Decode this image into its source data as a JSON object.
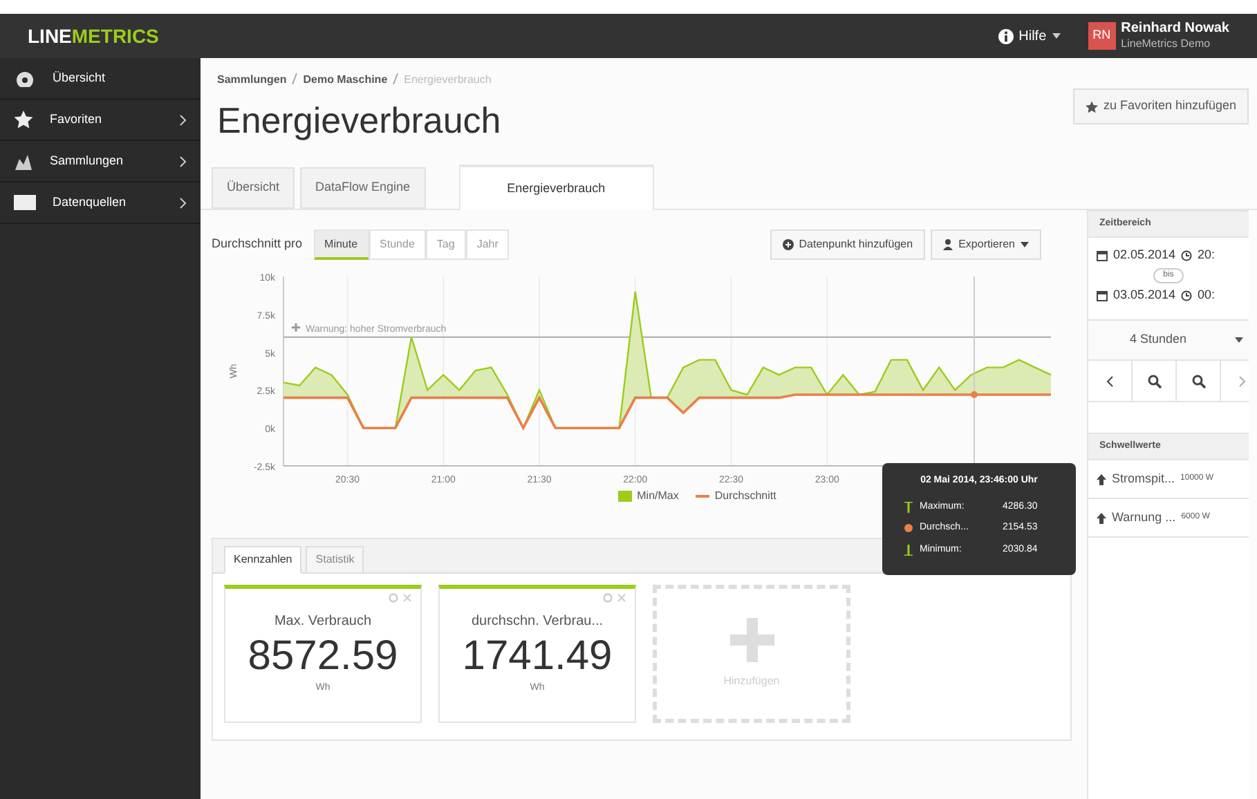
{
  "app": {
    "logo_left": "LINE",
    "logo_right": "METRICS"
  },
  "topbar": {
    "help": "Hilfe",
    "user": {
      "initials": "RN",
      "name": "Reinhard Nowak",
      "org": "LineMetrics Demo"
    }
  },
  "sidebar": {
    "items": [
      {
        "label": "Übersicht",
        "expandable": false
      },
      {
        "label": "Favoriten",
        "expandable": true
      },
      {
        "label": "Sammlungen",
        "expandable": true
      },
      {
        "label": "Datenquellen",
        "expandable": true
      }
    ]
  },
  "breadcrumb": [
    "Sammlungen",
    "Demo Maschine",
    "Energieverbrauch"
  ],
  "title": "Energieverbrauch",
  "favorite_button": "zu Favoriten hinzufügen",
  "tabs": [
    {
      "label": "Übersicht",
      "selected": false
    },
    {
      "label": "DataFlow Engine",
      "selected": false
    },
    {
      "label": "Energieverbrauch",
      "selected": true
    }
  ],
  "averaging": {
    "label": "Durchschnitt pro",
    "options": [
      {
        "label": "Minute",
        "selected": true
      },
      {
        "label": "Stunde",
        "selected": false
      },
      {
        "label": "Tag",
        "selected": false
      },
      {
        "label": "Jahr",
        "selected": false
      }
    ]
  },
  "chart_buttons": [
    "Datenpunkt hinzufügen",
    "Exportieren"
  ],
  "chart": {
    "chart_data": {
      "type": "line",
      "ylabel": "Wh",
      "categories": [
        null,
        null,
        null,
        null,
        "20:30",
        null,
        null,
        null,
        null,
        null,
        "21:00",
        null,
        null,
        null,
        null,
        null,
        "21:30",
        null,
        null,
        null,
        null,
        null,
        "22:00",
        null,
        null,
        null,
        null,
        null,
        "22:30",
        null,
        null,
        null,
        null,
        null,
        "23:00",
        null,
        null,
        null,
        null,
        null,
        null,
        null,
        null,
        null,
        null,
        null,
        null,
        null,
        null
      ],
      "series": [
        {
          "name": "Min/Max",
          "color": "#9ccc1c",
          "values": [
            3000,
            2800,
            4000,
            3500,
            2200,
            0,
            0,
            0,
            6000,
            2500,
            3500,
            2500,
            3800,
            4000,
            2200,
            0,
            2500,
            0,
            0,
            0,
            0,
            0,
            9000,
            2000,
            2000,
            4000,
            4500,
            4500,
            2500,
            2200,
            4000,
            3500,
            4000,
            4000,
            2200,
            3500,
            2200,
            2400,
            4500,
            4500,
            2500,
            4000,
            2500,
            3500,
            4000,
            4000,
            4500,
            4000,
            3500
          ]
        },
        {
          "name": "Durchschnitt",
          "color": "#e8804a",
          "values": [
            2000,
            2000,
            2000,
            2000,
            2000,
            0,
            0,
            0,
            2000,
            2000,
            2000,
            2000,
            2000,
            2000,
            2000,
            0,
            2000,
            0,
            0,
            0,
            0,
            0,
            2000,
            2000,
            2000,
            1000,
            2000,
            2000,
            2000,
            2000,
            2000,
            2000,
            2200,
            2200,
            2200,
            2200,
            2200,
            2200,
            2200,
            2200,
            2200,
            2200,
            2200,
            2200,
            2200,
            2200,
            2200,
            2200,
            2200
          ]
        }
      ],
      "ylim": [
        -2500,
        10000
      ],
      "yticks": [
        {
          "value": 10000,
          "label": "10k"
        },
        {
          "value": 7500,
          "label": "7.5k"
        },
        {
          "value": 5000,
          "label": "5k"
        },
        {
          "value": 2500,
          "label": "2.5k"
        },
        {
          "value": 0,
          "label": "0k"
        },
        {
          "value": -2500,
          "label": "-2.5k"
        }
      ],
      "grid": true,
      "ref_lines": [
        {
          "axis": "y",
          "value": 6000,
          "label": "Warnung: hoher Stromverbrauch"
        }
      ]
    },
    "tooltip": {
      "title": "02 Mai 2014, 23:46:00 Uhr",
      "rows": [
        {
          "label": "Maximum:",
          "value": "4286.30"
        },
        {
          "label": "Durchsch...",
          "value": "2154.53"
        },
        {
          "label": "Minimum:",
          "value": "2030.84"
        }
      ]
    }
  },
  "bottom_tabs": [
    {
      "label": "Kennzahlen",
      "selected": true
    },
    {
      "label": "Statistik",
      "selected": false
    }
  ],
  "kpis": [
    {
      "title": "Max. Verbrauch",
      "value": "8572.59",
      "unit": "Wh"
    },
    {
      "title": "durchschn. Verbrau...",
      "value": "1741.49",
      "unit": "Wh"
    }
  ],
  "add_kpi": "Hinzufügen",
  "time_range": {
    "title": "Zeitbereich",
    "from_date": "02.05.2014",
    "from_time": "20:",
    "to_label": "bis",
    "to_date": "03.05.2014",
    "to_time": "00:",
    "duration": "4 Stunden"
  },
  "thresholds": {
    "title": "Schwellwerte",
    "items": [
      {
        "label": "Stromspit...",
        "value": "10000 W"
      },
      {
        "label": "Warnung ...",
        "value": "6000 W"
      }
    ]
  }
}
